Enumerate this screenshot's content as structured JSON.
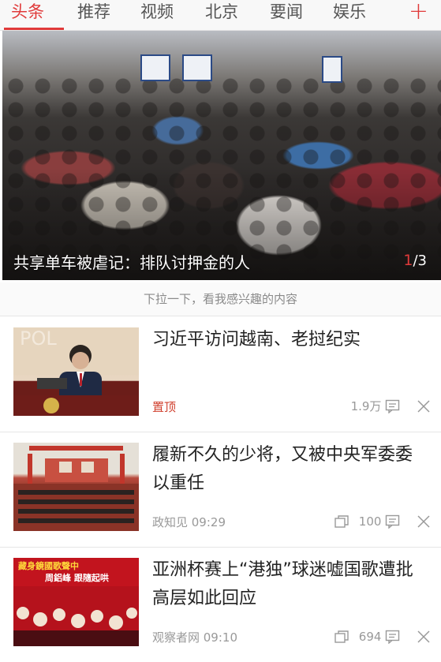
{
  "tabs": [
    {
      "label": "头条",
      "active": true
    },
    {
      "label": "推荐",
      "active": false
    },
    {
      "label": "视频",
      "active": false
    },
    {
      "label": "北京",
      "active": false
    },
    {
      "label": "要闻",
      "active": false
    },
    {
      "label": "娱乐",
      "active": false
    }
  ],
  "add_label": "+",
  "hero": {
    "caption": "共享单车被虐记：排队讨押金的人",
    "current": "1",
    "total": "/3"
  },
  "pull_hint": "下拉一下，看我感兴趣的内容",
  "news": [
    {
      "title": "习近平访问越南、老挝纪实",
      "left_meta": "置顶",
      "pinned": true,
      "comments": "1.9万",
      "has_gallery_icon": false
    },
    {
      "title": "履新不久的少将，又被中央军委委以重任",
      "left_meta": "政知见  09:29",
      "pinned": false,
      "comments": "100",
      "has_gallery_icon": true
    },
    {
      "title": "亚洲杯赛上“港独”球迷嘘国歌遭批 高层如此回应",
      "left_meta": "观察者网  09:10",
      "pinned": false,
      "comments": "694",
      "has_gallery_icon": true,
      "thumb_text_1": "藏身鏡國歌聲中",
      "thumb_text_2": "周鋁峰 跟隨起哄"
    }
  ],
  "colors": {
    "accent": "#e03a3a",
    "meta": "#999999"
  }
}
